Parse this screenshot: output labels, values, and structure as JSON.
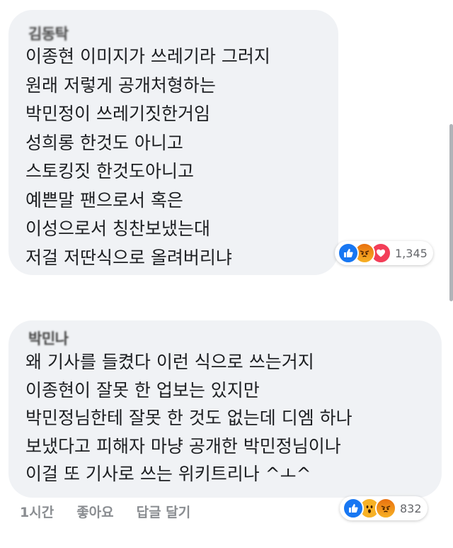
{
  "comments": [
    {
      "author": "김동탁",
      "lines": [
        "이종현 이미지가 쓰레기라 그러지",
        "원래 저렇게 공개처형하는",
        "박민정이 쓰레기짓한거임",
        "성희롱 한것도 아니고",
        "스토킹짓 한것도아니고",
        "예쁜말 팬으로서 혹은",
        "이성으로서 칭찬보냈는대",
        "저걸 저딴식으로 올려버리냐"
      ],
      "reactions": {
        "icons": [
          "like-icon",
          "angry-icon",
          "love-icon"
        ],
        "count": "1,345"
      }
    },
    {
      "author": "박민나",
      "lines": [
        "왜 기사를 들켰다 이런 식으로 쓰는거지",
        "이종현이 잘못 한 업보는 있지만",
        "박민정님한테 잘못 한 것도 없는데 디엠 하나",
        "보냈다고 피해자 마냥 공개한 박민정님이나",
        "이걸 또 기사로 쓰는 위키트리나 ^ㅗ^"
      ],
      "reactions": {
        "icons": [
          "like-icon",
          "wow-icon",
          "angry-icon"
        ],
        "count": "832"
      },
      "actions": {
        "time": "1시간",
        "like": "좋아요",
        "reply": "답글 달기"
      }
    }
  ],
  "colors": {
    "bubble": "#f0f2f5",
    "like": "#1877f2",
    "love": "#f33e58",
    "angry": "#e9710f",
    "meta": "#65676b"
  }
}
